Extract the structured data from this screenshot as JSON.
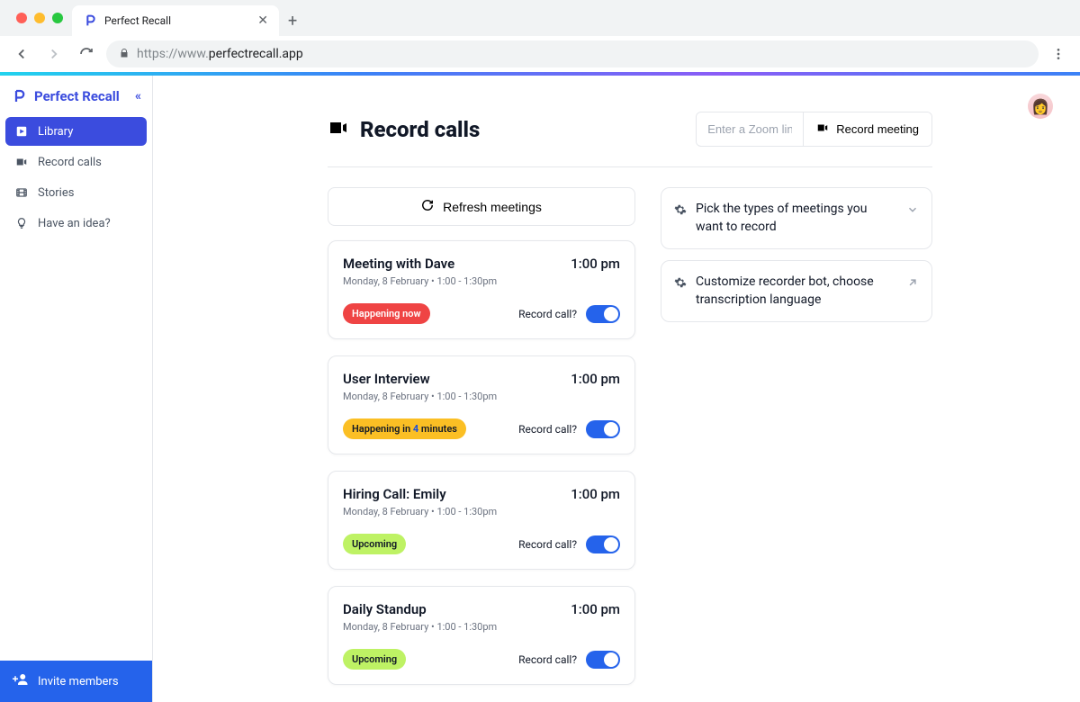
{
  "browser": {
    "tab_title": "Perfect Recall",
    "url_prefix": "https://www.",
    "url_host": "perfectrecall.app"
  },
  "sidebar": {
    "brand": "Perfect Recall",
    "items": [
      {
        "label": "Library",
        "icon": "library-icon",
        "active": true
      },
      {
        "label": "Record calls",
        "icon": "camera-icon",
        "active": false
      },
      {
        "label": "Stories",
        "icon": "film-icon",
        "active": false
      },
      {
        "label": "Have an idea?",
        "icon": "lightbulb-icon",
        "active": false
      }
    ],
    "invite_label": "Invite members"
  },
  "header": {
    "title": "Record calls",
    "zoom_placeholder": "Enter a Zoom link...",
    "record_button": "Record meeting"
  },
  "refresh_label": "Refresh meetings",
  "meetings": [
    {
      "title": "Meeting with Dave",
      "time": "1:00 pm",
      "subtitle": "Monday, 8 February  •  1:00 - 1:30pm",
      "status_text": "Happening now",
      "status_class": "badge-red",
      "record_label": "Record call?"
    },
    {
      "title": "User Interview",
      "time": "1:00 pm",
      "subtitle": "Monday, 8 February  •  1:00 - 1:30pm",
      "status_prefix": "Happening in ",
      "status_count": "4",
      "status_suffix": " minutes",
      "status_class": "badge-amber",
      "record_label": "Record call?"
    },
    {
      "title": "Hiring Call: Emily",
      "time": "1:00 pm",
      "subtitle": "Monday, 8 February  •  1:00 - 1:30pm",
      "status_text": "Upcoming",
      "status_class": "badge-lime",
      "record_label": "Record call?"
    },
    {
      "title": "Daily Standup",
      "time": "1:00 pm",
      "subtitle": "Monday, 8 February  •  1:00 - 1:30pm",
      "status_text": "Upcoming",
      "status_class": "badge-lime",
      "record_label": "Record call?"
    }
  ],
  "settings": [
    {
      "text": "Pick the types of meetings you want to record",
      "chevron": "down"
    },
    {
      "text": "Customize recorder bot, choose transcription language",
      "chevron": "arrow"
    }
  ]
}
